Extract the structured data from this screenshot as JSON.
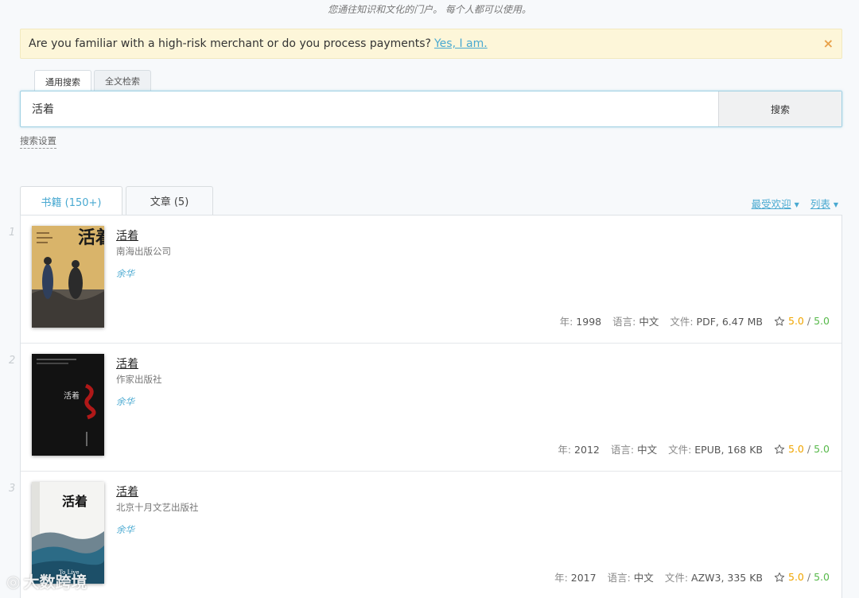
{
  "tagline": "您通往知识和文化的门户。 每个人都可以使用。",
  "alert": {
    "text": "Are you familiar with a high-risk merchant or do you process payments?",
    "link": "Yes, I am.",
    "close": "×"
  },
  "search": {
    "tabs": [
      "通用搜索",
      "全文检索"
    ],
    "value": "活着",
    "button": "搜索",
    "settings": "搜索设置"
  },
  "results_tabs": [
    {
      "label": "书籍 (150+)"
    },
    {
      "label": "文章 (5)"
    }
  ],
  "sort": {
    "popular": "最受欢迎",
    "view": "列表"
  },
  "books": [
    {
      "num": "1",
      "title": "活着",
      "publisher": "南海出版公司",
      "author": "余华",
      "year_key": "年:",
      "year": "1998",
      "lang_key": "语言:",
      "lang": "中文",
      "file_key": "文件:",
      "file": "PDF, 6.47 MB",
      "rating": "5.0",
      "rating_max": "5.0",
      "cover_text": "活着"
    },
    {
      "num": "2",
      "title": "活着",
      "publisher": "作家出版社",
      "author": "余华",
      "year_key": "年:",
      "year": "2012",
      "lang_key": "语言:",
      "lang": "中文",
      "file_key": "文件:",
      "file": "EPUB, 168 KB",
      "rating": "5.0",
      "rating_max": "5.0",
      "cover_text": "活着"
    },
    {
      "num": "3",
      "title": "活着",
      "publisher": "北京十月文艺出版社",
      "author": "余华",
      "year_key": "年:",
      "year": "2017",
      "lang_key": "语言:",
      "lang": "中文",
      "file_key": "文件:",
      "file": "AZW3, 335 KB",
      "rating": "5.0",
      "rating_max": "5.0",
      "cover_text": "活着",
      "cover_subtitle": "To Live"
    }
  ],
  "watermark": "大数跨境",
  "colors": {
    "accent": "#49a9d1",
    "rating": "#f0a500",
    "rating_max": "#57b94a",
    "alert_bg": "#fdf6d9"
  }
}
